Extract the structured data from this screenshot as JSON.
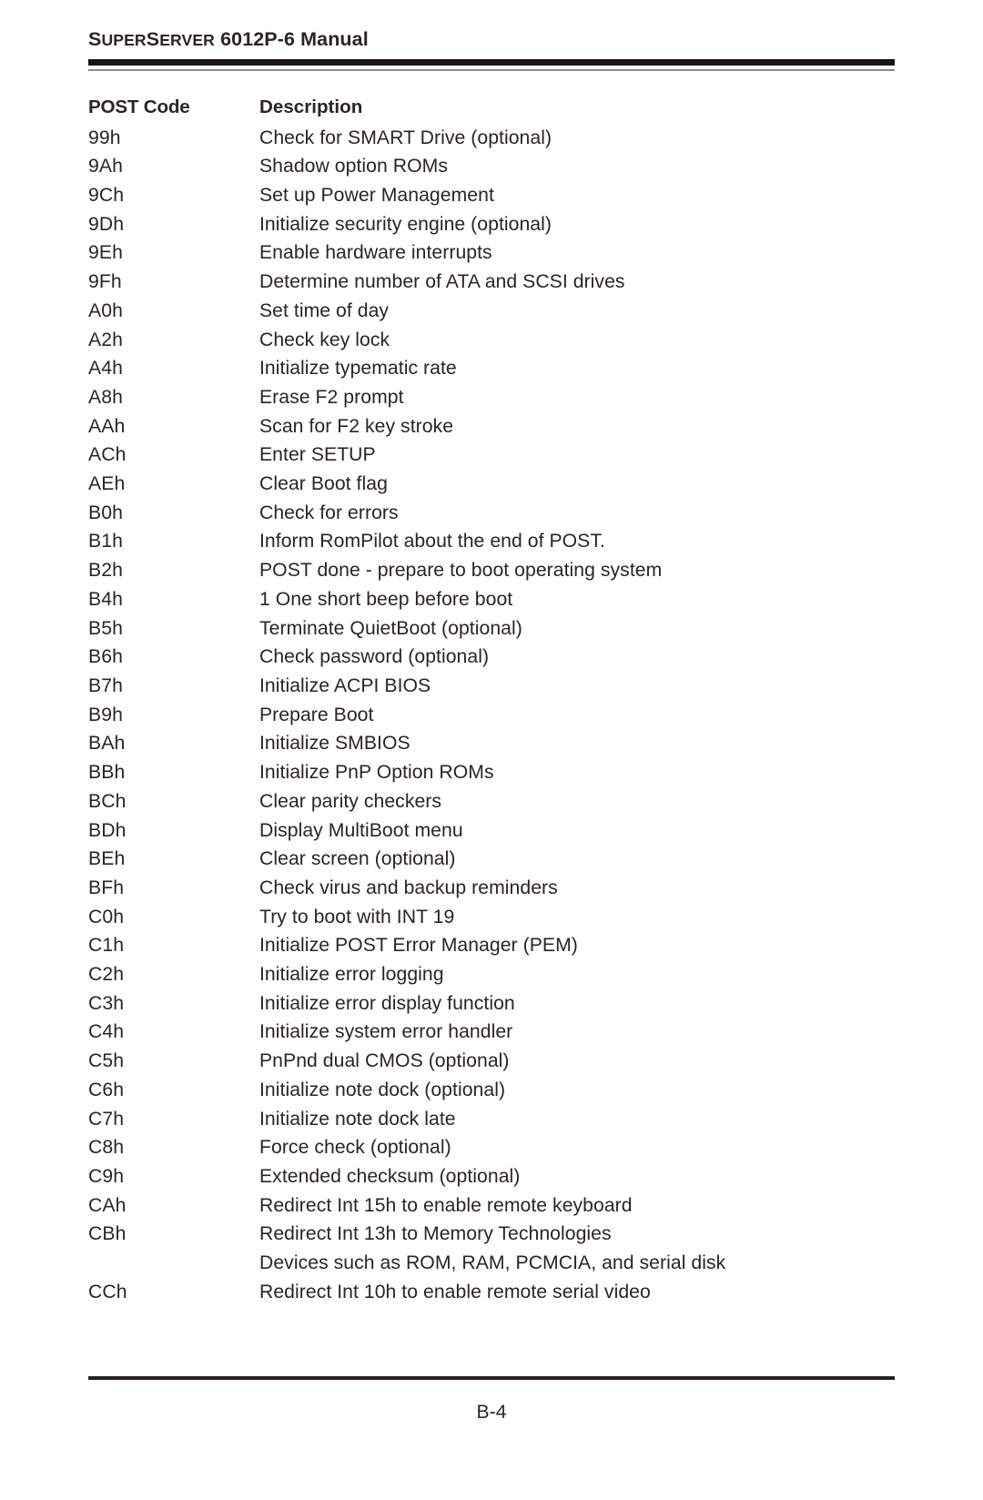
{
  "header": {
    "title_parts": {
      "s1": "S",
      "uper": "UPER",
      "s2": "S",
      "erver": "ERVER",
      "model": " 6012P-6 Manual"
    },
    "title_full": "SUPERSERVER 6012P-6 Manual"
  },
  "table": {
    "columns": [
      "POST Code",
      "Description"
    ],
    "rows": [
      {
        "code": "99h",
        "desc": "Check for SMART Drive (optional)"
      },
      {
        "code": "9Ah",
        "desc": "Shadow option ROMs"
      },
      {
        "code": "9Ch",
        "desc": "Set up Power Management"
      },
      {
        "code": "9Dh",
        "desc": "Initialize security engine (optional)"
      },
      {
        "code": "9Eh",
        "desc": "Enable hardware interrupts"
      },
      {
        "code": "9Fh",
        "desc": "Determine number of ATA and SCSI drives"
      },
      {
        "code": "A0h",
        "desc": "Set time of day"
      },
      {
        "code": "A2h",
        "desc": "Check key lock"
      },
      {
        "code": "A4h",
        "desc": "Initialize typematic rate"
      },
      {
        "code": "A8h",
        "desc": "Erase F2 prompt"
      },
      {
        "code": "AAh",
        "desc": "Scan for F2 key stroke"
      },
      {
        "code": "ACh",
        "desc": "Enter SETUP"
      },
      {
        "code": "AEh",
        "desc": "Clear Boot flag"
      },
      {
        "code": "B0h",
        "desc": "Check for errors"
      },
      {
        "code": "B1h",
        "desc": "Inform RomPilot about the end of POST."
      },
      {
        "code": "B2h",
        "desc": "POST done - prepare to boot operating system"
      },
      {
        "code": "B4h",
        "desc": "1 One short beep before boot"
      },
      {
        "code": "B5h",
        "desc": "Terminate QuietBoot (optional)"
      },
      {
        "code": "B6h",
        "desc": "Check password (optional)"
      },
      {
        "code": "B7h",
        "desc": "Initialize ACPI BIOS"
      },
      {
        "code": "B9h",
        "desc": "Prepare Boot"
      },
      {
        "code": "BAh",
        "desc": "Initialize SMBIOS"
      },
      {
        "code": "BBh",
        "desc": "Initialize PnP Option ROMs"
      },
      {
        "code": "BCh",
        "desc": "Clear parity checkers"
      },
      {
        "code": "BDh",
        "desc": "Display MultiBoot menu"
      },
      {
        "code": "BEh",
        "desc": "Clear screen (optional)"
      },
      {
        "code": "BFh",
        "desc": "Check virus and backup reminders"
      },
      {
        "code": "C0h",
        "desc": "Try to boot with INT 19"
      },
      {
        "code": "C1h",
        "desc": "Initialize POST Error Manager (PEM)"
      },
      {
        "code": "C2h",
        "desc": "Initialize error logging"
      },
      {
        "code": "C3h",
        "desc": "Initialize error display function"
      },
      {
        "code": "C4h",
        "desc": "Initialize system error handler"
      },
      {
        "code": "C5h",
        "desc": "PnPnd dual CMOS (optional)"
      },
      {
        "code": "C6h",
        "desc": "Initialize note dock (optional)"
      },
      {
        "code": "C7h",
        "desc": "Initialize note dock late"
      },
      {
        "code": "C8h",
        "desc": "Force check (optional)"
      },
      {
        "code": "C9h",
        "desc": "Extended checksum (optional)"
      },
      {
        "code": "CAh",
        "desc": "Redirect Int 15h to enable remote keyboard"
      },
      {
        "code": "CBh",
        "desc": "Redirect Int 13h to Memory Technologies"
      },
      {
        "code": "",
        "desc": "Devices such as ROM, RAM, PCMCIA, and serial disk",
        "continuation": true
      },
      {
        "code": "CCh",
        "desc": "Redirect Int 10h to enable remote serial video"
      }
    ]
  },
  "footer": {
    "page_number": "B-4"
  }
}
